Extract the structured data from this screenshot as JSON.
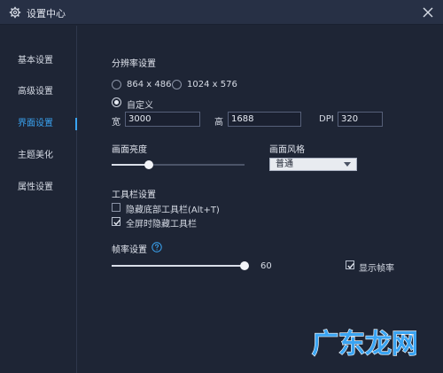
{
  "window": {
    "title": "设置中心",
    "close_icon": "close-icon",
    "gear_icon": "gear-icon"
  },
  "sidebar": {
    "items": [
      {
        "label": "基本设置",
        "active": false
      },
      {
        "label": "高级设置",
        "active": false
      },
      {
        "label": "界面设置",
        "active": true
      },
      {
        "label": "主题美化",
        "active": false
      },
      {
        "label": "属性设置",
        "active": false
      }
    ]
  },
  "resolution": {
    "title": "分辨率设置",
    "options": [
      {
        "label": "864 x 486",
        "selected": false
      },
      {
        "label": "1024 x 576",
        "selected": false
      },
      {
        "label": "自定义",
        "selected": true
      }
    ],
    "width_label": "宽",
    "width_value": "3000",
    "height_label": "高",
    "height_value": "1688",
    "dpi_label": "DPI",
    "dpi_value": "320"
  },
  "brightness": {
    "title": "画面亮度",
    "level_fraction": 0.28
  },
  "style": {
    "title": "画面风格",
    "selected": "普通"
  },
  "toolbar": {
    "title": "工具栏设置",
    "options": [
      {
        "label": "隐藏底部工具栏(Alt+T)",
        "checked": false
      },
      {
        "label": "全屏时隐藏工具栏",
        "checked": true
      }
    ]
  },
  "framerate": {
    "title": "帧率设置",
    "help_icon": "help-icon",
    "value_label": "60",
    "level_fraction": 1.0,
    "show_fps_label": "显示帧率",
    "show_fps_checked": true
  },
  "watermark": {
    "text": "广东龙网",
    "color": "#3aa4f2"
  },
  "colors": {
    "accent": "#3aa4f2",
    "background": "#1e2535",
    "titlebar": "#273045"
  }
}
